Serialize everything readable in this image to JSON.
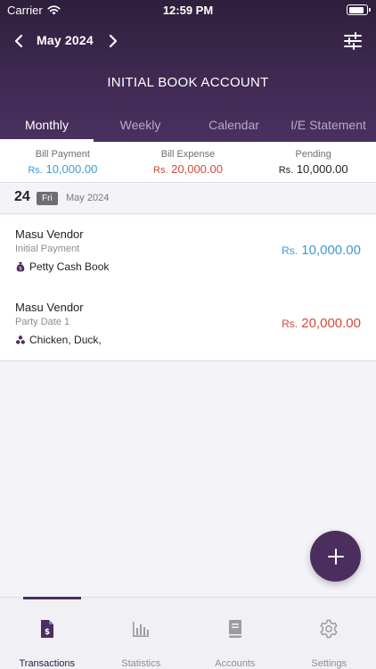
{
  "status_bar": {
    "carrier": "Carrier",
    "time": "12:59 PM",
    "battery_level": 0.9
  },
  "nav": {
    "month": "May 2024"
  },
  "account": {
    "title": "INITIAL BOOK ACCOUNT"
  },
  "tabs": [
    {
      "label": "Monthly",
      "active": true
    },
    {
      "label": "Weekly",
      "active": false
    },
    {
      "label": "Calendar",
      "active": false
    },
    {
      "label": "I/E Statement",
      "active": false
    }
  ],
  "summary": {
    "currency": "Rs.",
    "bill_payment": {
      "label": "Bill Payment",
      "amount": "10,000.00"
    },
    "bill_expense": {
      "label": "Bill Expense",
      "amount": "20,000.00"
    },
    "pending": {
      "label": "Pending",
      "amount": "10,000.00"
    }
  },
  "date_group": {
    "day": "24",
    "weekday": "Fri",
    "month_year": "May 2024"
  },
  "transactions": [
    {
      "vendor": "Masu Vendor",
      "note": "Initial Payment",
      "book": "Petty Cash Book",
      "currency": "Rs.",
      "amount": "10,000.00"
    },
    {
      "vendor": "Masu Vendor",
      "note": "Party Date 1",
      "book": "Chicken, Duck,",
      "currency": "Rs.",
      "amount": "20,000.00"
    }
  ],
  "bottom_nav": [
    {
      "label": "Transactions",
      "icon": "invoice-icon",
      "active": true
    },
    {
      "label": "Statistics",
      "icon": "bar-chart-icon",
      "active": false
    },
    {
      "label": "Accounts",
      "icon": "book-icon",
      "active": false
    },
    {
      "label": "Settings",
      "icon": "gear-icon",
      "active": false
    }
  ],
  "colors": {
    "header": "#3f2a52",
    "income": "#3e9bd3",
    "expense": "#d14b3c",
    "accent": "#4b2e5e"
  }
}
